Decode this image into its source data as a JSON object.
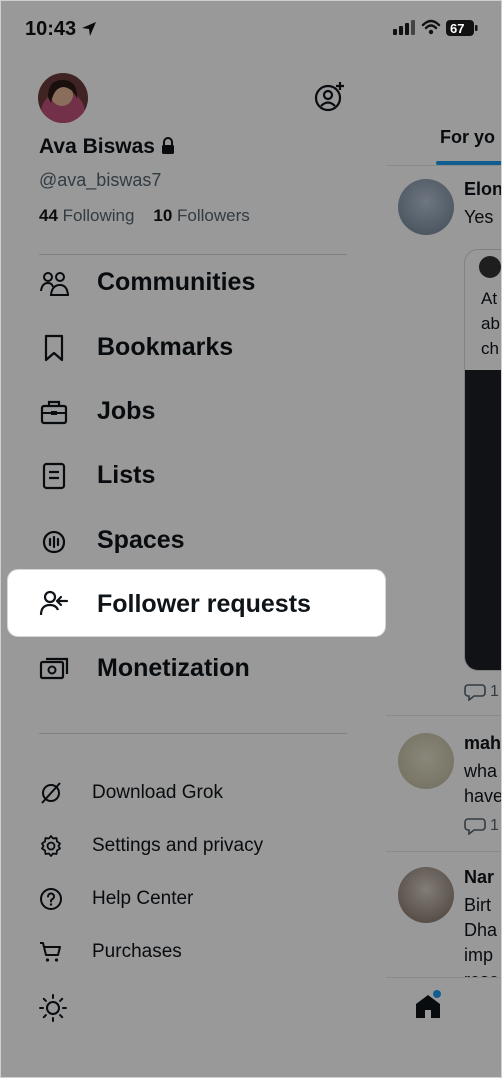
{
  "status_bar": {
    "time": "10:43",
    "battery": "67"
  },
  "profile": {
    "name": "Ava Biswas",
    "handle": "@ava_biswas7",
    "following_count": "44",
    "following_label": "Following",
    "followers_count": "10",
    "followers_label": "Followers"
  },
  "menu": {
    "items": [
      {
        "label": "Communities",
        "icon": "communities-icon"
      },
      {
        "label": "Bookmarks",
        "icon": "bookmark-icon"
      },
      {
        "label": "Jobs",
        "icon": "briefcase-icon"
      },
      {
        "label": "Lists",
        "icon": "list-icon"
      },
      {
        "label": "Spaces",
        "icon": "spaces-icon"
      },
      {
        "label": "Follower requests",
        "icon": "follower-request-icon",
        "highlighted": true
      },
      {
        "label": "Monetization",
        "icon": "monetization-icon"
      }
    ],
    "secondary": [
      {
        "label": "Download Grok",
        "icon": "grok-icon"
      },
      {
        "label": "Settings and privacy",
        "icon": "gear-icon"
      },
      {
        "label": "Help Center",
        "icon": "help-icon"
      },
      {
        "label": "Purchases",
        "icon": "cart-icon"
      }
    ],
    "theme_icon": "sun-icon"
  },
  "feed": {
    "tab_label": "For yo",
    "posts": [
      {
        "name": "Elon",
        "text": "Yes"
      },
      {
        "name": "mah",
        "text": "wha\nhave"
      },
      {
        "name": "Nar",
        "text": "Birt\nDha\nimp\nrese"
      }
    ],
    "quote_text": "At\nab\nch",
    "reply_count": "1"
  },
  "colors": {
    "accent": "#1d9bf0",
    "text": "#0f1419",
    "muted": "#536471"
  }
}
